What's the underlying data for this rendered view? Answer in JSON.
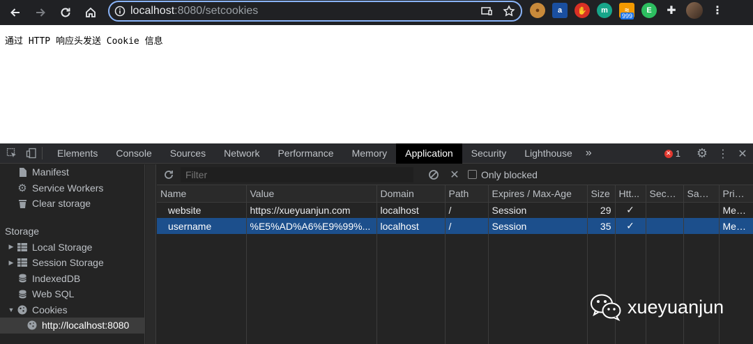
{
  "browser": {
    "url_host": "localhost",
    "url_path": ":8080/setcookies",
    "extensions": [
      {
        "name": "cookie-extension-icon",
        "color": "#c98a3a"
      },
      {
        "name": "translate-extension-icon",
        "color": "#1a4fa0"
      },
      {
        "name": "adblock-extension-icon",
        "color": "#d93025"
      },
      {
        "name": "teal-extension-icon",
        "color": "#17a589"
      },
      {
        "name": "rss-extension-icon",
        "color": "#f29900",
        "badge": "999"
      },
      {
        "name": "evernote-extension-icon",
        "color": "#2dbe60"
      }
    ]
  },
  "page": {
    "text": "通过 HTTP 响应头发送 Cookie 信息"
  },
  "devtools": {
    "tabs": [
      "Elements",
      "Console",
      "Sources",
      "Network",
      "Performance",
      "Memory",
      "Application",
      "Security",
      "Lighthouse"
    ],
    "active_tab": "Application",
    "more_tabs": "»",
    "error_count": "1",
    "sidebar": {
      "top_items": [
        "Manifest",
        "Service Workers",
        "Clear storage"
      ],
      "storage_label": "Storage",
      "storage_items": [
        "Local Storage",
        "Session Storage",
        "IndexedDB",
        "Web SQL",
        "Cookies"
      ],
      "cookie_origin": "http://localhost:8080"
    },
    "filter": {
      "placeholder": "Filter",
      "only_blocked": "Only blocked"
    },
    "columns": [
      "Name",
      "Value",
      "Domain",
      "Path",
      "Expires / Max-Age",
      "Size",
      "Htt...",
      "Secure",
      "Sam...",
      "Priority"
    ],
    "rows": [
      {
        "name": "website",
        "value": "https://xueyuanjun.com",
        "domain": "localhost",
        "path": "/",
        "expires": "Session",
        "size": "29",
        "httponly": "✓",
        "secure": "",
        "samesite": "",
        "priority": "Med..."
      },
      {
        "name": "username",
        "value": "%E5%AD%A6%E9%99%...",
        "domain": "localhost",
        "path": "/",
        "expires": "Session",
        "size": "35",
        "httponly": "✓",
        "secure": "",
        "samesite": "",
        "priority": "Med..."
      }
    ]
  },
  "watermark": "xueyuanjun",
  "colors": {
    "accent": "#8ab4f8",
    "selection": "#1c4f8c",
    "error": "#e2382e"
  }
}
